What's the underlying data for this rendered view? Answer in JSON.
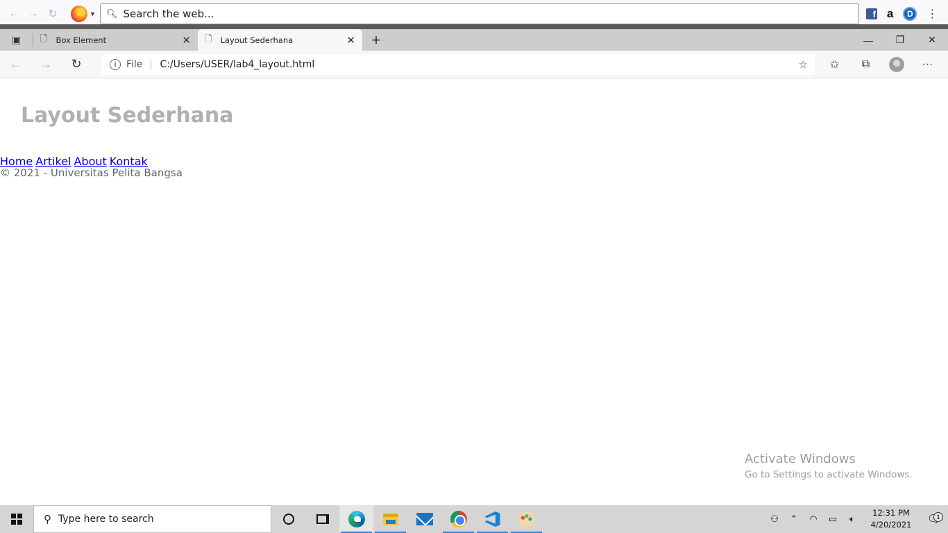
{
  "firefox": {
    "search_placeholder": "Search the web...",
    "ext_amazon": "a",
    "ext_d": "D",
    "ext_fb": "f"
  },
  "tabs": [
    {
      "title": "Box Element",
      "active": false
    },
    {
      "title": "Layout Sederhana",
      "active": true
    }
  ],
  "address": {
    "scheme": "File",
    "url": "C:/Users/USER/lab4_layout.html"
  },
  "page": {
    "heading": "Layout Sederhana",
    "nav": [
      "Home",
      "Artikel",
      "About",
      "Kontak"
    ],
    "footer": "© 2021 - Universitas Pelita Bangsa"
  },
  "watermark": {
    "line1": "Activate Windows",
    "line2": "Go to Settings to activate Windows."
  },
  "taskbar": {
    "search_placeholder": "Type here to search",
    "time": "12:31 PM",
    "date": "4/20/2021",
    "notification_count": "1"
  }
}
